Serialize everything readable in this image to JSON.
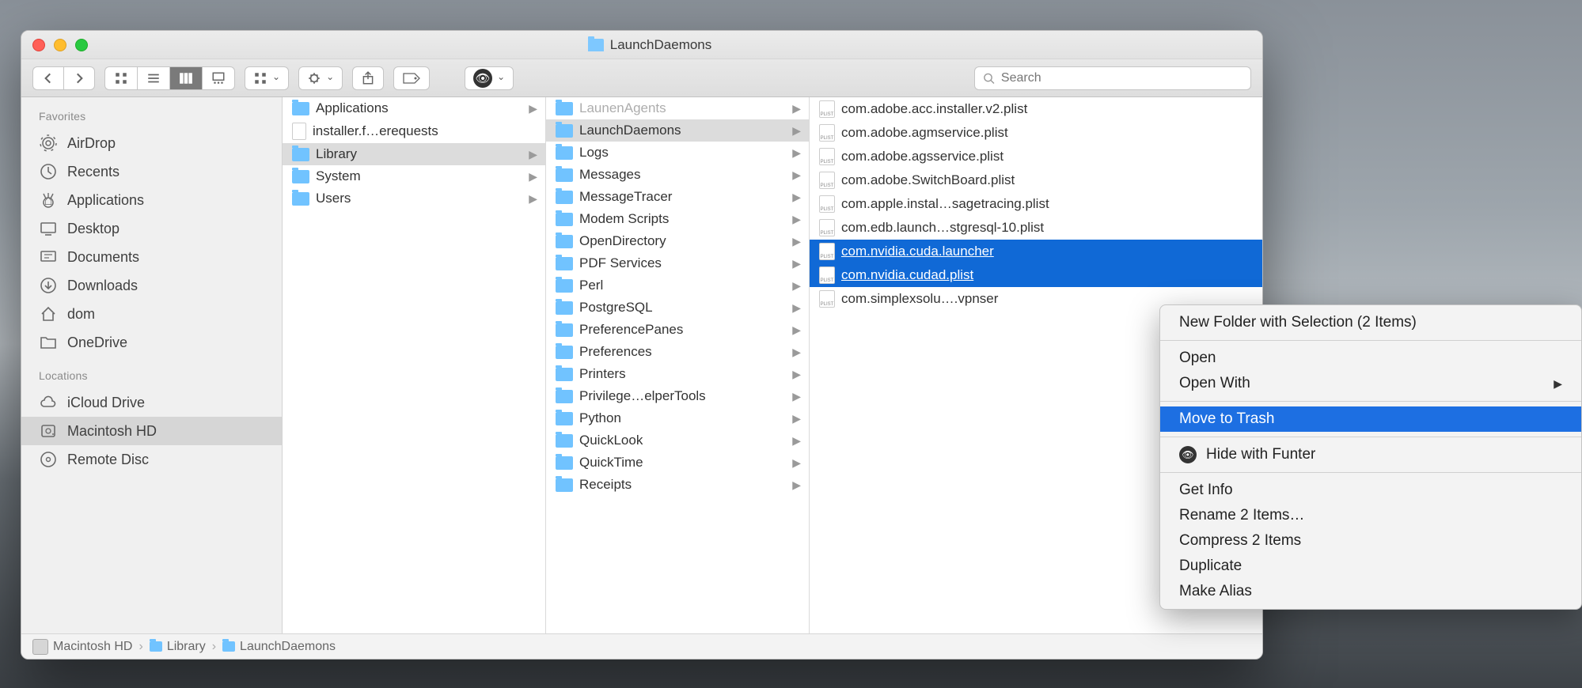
{
  "window": {
    "title": "LaunchDaemons"
  },
  "toolbar": {
    "search_placeholder": "Search"
  },
  "sidebar": {
    "section1": "Favorites",
    "favorites": [
      {
        "label": "AirDrop",
        "icon": "airdrop"
      },
      {
        "label": "Recents",
        "icon": "clock"
      },
      {
        "label": "Applications",
        "icon": "app"
      },
      {
        "label": "Desktop",
        "icon": "desktop"
      },
      {
        "label": "Documents",
        "icon": "doc"
      },
      {
        "label": "Downloads",
        "icon": "down"
      },
      {
        "label": "dom",
        "icon": "home"
      },
      {
        "label": "OneDrive",
        "icon": "folder"
      }
    ],
    "section2": "Locations",
    "locations": [
      {
        "label": "iCloud Drive",
        "icon": "cloud"
      },
      {
        "label": "Macintosh HD",
        "icon": "hd",
        "selected": true
      },
      {
        "label": "Remote Disc",
        "icon": "disc"
      }
    ]
  },
  "columns": {
    "col1": [
      {
        "label": "Applications",
        "folder": true
      },
      {
        "label": "installer.f…erequests",
        "file": true
      },
      {
        "label": "Library",
        "folder": true,
        "selected": true
      },
      {
        "label": "System",
        "folder": true
      },
      {
        "label": "Users",
        "folder": true
      }
    ],
    "col2": [
      {
        "label": "LaunenAgents",
        "folder": true,
        "cut": true
      },
      {
        "label": "LaunchDaemons",
        "folder": true,
        "selected": true
      },
      {
        "label": "Logs",
        "folder": true
      },
      {
        "label": "Messages",
        "folder": true
      },
      {
        "label": "MessageTracer",
        "folder": true
      },
      {
        "label": "Modem Scripts",
        "folder": true
      },
      {
        "label": "OpenDirectory",
        "folder": true
      },
      {
        "label": "PDF Services",
        "folder": true
      },
      {
        "label": "Perl",
        "folder": true
      },
      {
        "label": "PostgreSQL",
        "folder": true
      },
      {
        "label": "PreferencePanes",
        "folder": true
      },
      {
        "label": "Preferences",
        "folder": true
      },
      {
        "label": "Printers",
        "folder": true
      },
      {
        "label": "Privilege…elperTools",
        "folder": true
      },
      {
        "label": "Python",
        "folder": true
      },
      {
        "label": "QuickLook",
        "folder": true
      },
      {
        "label": "QuickTime",
        "folder": true
      },
      {
        "label": "Receipts",
        "folder": true
      }
    ],
    "col3": [
      {
        "label": "com.adobe.acc.installer.v2.plist"
      },
      {
        "label": "com.adobe.agmservice.plist"
      },
      {
        "label": "com.adobe.agsservice.plist"
      },
      {
        "label": "com.adobe.SwitchBoard.plist"
      },
      {
        "label": "com.apple.instal…sagetracing.plist"
      },
      {
        "label": "com.edb.launch…stgresql-10.plist"
      },
      {
        "label": "com.nvidia.cuda.launcher",
        "selected": true
      },
      {
        "label": "com.nvidia.cudad.plist",
        "selected": true
      },
      {
        "label": "com.simplexsolu….vpnser"
      }
    ]
  },
  "pathbar": {
    "p1": "Macintosh HD",
    "p2": "Library",
    "p3": "LaunchDaemons"
  },
  "context_menu": {
    "new_folder": "New Folder with Selection (2 Items)",
    "open": "Open",
    "open_with": "Open With",
    "move_trash": "Move to Trash",
    "hide_funter": "Hide with Funter",
    "get_info": "Get Info",
    "rename": "Rename 2 Items…",
    "compress": "Compress 2 Items",
    "duplicate": "Duplicate",
    "make_alias": "Make Alias"
  }
}
